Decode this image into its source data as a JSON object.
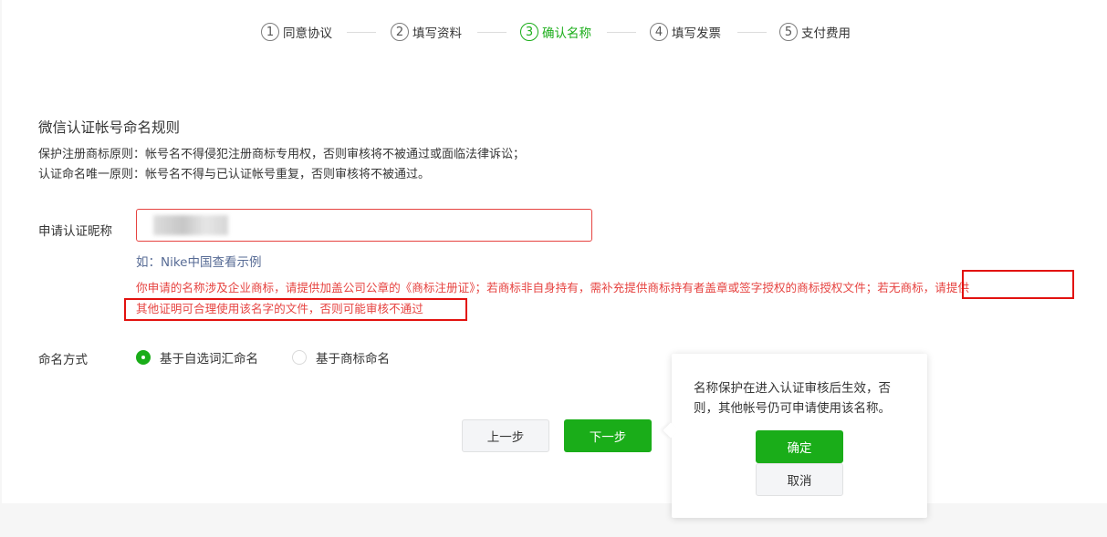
{
  "steps": [
    {
      "num": "1",
      "label": "同意协议"
    },
    {
      "num": "2",
      "label": "填写资料"
    },
    {
      "num": "3",
      "label": "确认名称"
    },
    {
      "num": "4",
      "label": "填写发票"
    },
    {
      "num": "5",
      "label": "支付费用"
    }
  ],
  "rules": {
    "title": "微信认证帐号命名规则",
    "line1": "保护注册商标原则：帐号名不得侵犯注册商标专用权，否则审核将不被通过或面临法律诉讼；",
    "line2": "认证命名唯一原则：帐号名不得与已认证帐号重复，否则审核将不被通过。"
  },
  "nickname": {
    "label": "申请认证昵称",
    "value": "",
    "example": "如：Nike中国查看示例",
    "warning_line1": "你申请的名称涉及企业商标，请提供加盖公司公章的《商标注册证》；若商标非自身持有，需补充提供商标持有者盖章或签字授权的商标授权文件；若无商标，请提供",
    "warning_line2": "其他证明可合理使用该名字的文件，否则可能审核不通过"
  },
  "naming": {
    "label": "命名方式",
    "options": [
      {
        "label": "基于自选词汇命名",
        "checked": true
      },
      {
        "label": "基于商标命名",
        "checked": false
      }
    ]
  },
  "buttons": {
    "prev": "上一步",
    "next": "下一步"
  },
  "popover": {
    "line1": "名称保护在进入认证审核后生效，否",
    "line2": "则，其他帐号仍可申请使用该名称。",
    "ok": "确定",
    "cancel": "取消"
  },
  "colors": {
    "accent": "#1aad19",
    "error": "#e64340",
    "link": "#576b95"
  }
}
